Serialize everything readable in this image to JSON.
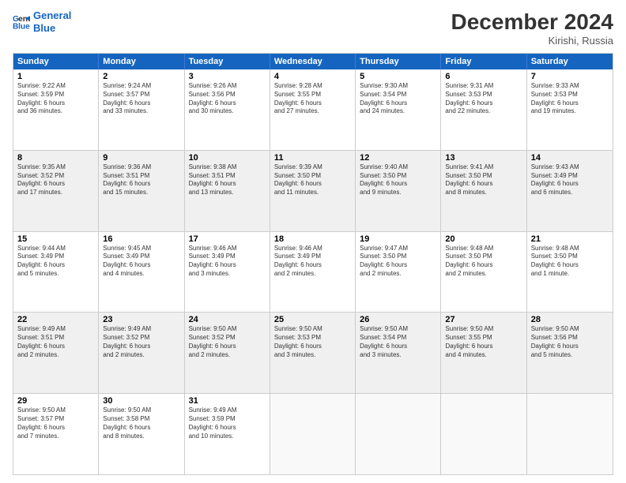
{
  "logo": {
    "line1": "General",
    "line2": "Blue"
  },
  "title": "December 2024",
  "subtitle": "Kirishi, Russia",
  "header_days": [
    "Sunday",
    "Monday",
    "Tuesday",
    "Wednesday",
    "Thursday",
    "Friday",
    "Saturday"
  ],
  "weeks": [
    [
      {
        "day": "1",
        "text": "Sunrise: 9:22 AM\nSunset: 3:59 PM\nDaylight: 6 hours\nand 36 minutes."
      },
      {
        "day": "2",
        "text": "Sunrise: 9:24 AM\nSunset: 3:57 PM\nDaylight: 6 hours\nand 33 minutes."
      },
      {
        "day": "3",
        "text": "Sunrise: 9:26 AM\nSunset: 3:56 PM\nDaylight: 6 hours\nand 30 minutes."
      },
      {
        "day": "4",
        "text": "Sunrise: 9:28 AM\nSunset: 3:55 PM\nDaylight: 6 hours\nand 27 minutes."
      },
      {
        "day": "5",
        "text": "Sunrise: 9:30 AM\nSunset: 3:54 PM\nDaylight: 6 hours\nand 24 minutes."
      },
      {
        "day": "6",
        "text": "Sunrise: 9:31 AM\nSunset: 3:53 PM\nDaylight: 6 hours\nand 22 minutes."
      },
      {
        "day": "7",
        "text": "Sunrise: 9:33 AM\nSunset: 3:53 PM\nDaylight: 6 hours\nand 19 minutes."
      }
    ],
    [
      {
        "day": "8",
        "text": "Sunrise: 9:35 AM\nSunset: 3:52 PM\nDaylight: 6 hours\nand 17 minutes."
      },
      {
        "day": "9",
        "text": "Sunrise: 9:36 AM\nSunset: 3:51 PM\nDaylight: 6 hours\nand 15 minutes."
      },
      {
        "day": "10",
        "text": "Sunrise: 9:38 AM\nSunset: 3:51 PM\nDaylight: 6 hours\nand 13 minutes."
      },
      {
        "day": "11",
        "text": "Sunrise: 9:39 AM\nSunset: 3:50 PM\nDaylight: 6 hours\nand 11 minutes."
      },
      {
        "day": "12",
        "text": "Sunrise: 9:40 AM\nSunset: 3:50 PM\nDaylight: 6 hours\nand 9 minutes."
      },
      {
        "day": "13",
        "text": "Sunrise: 9:41 AM\nSunset: 3:50 PM\nDaylight: 6 hours\nand 8 minutes."
      },
      {
        "day": "14",
        "text": "Sunrise: 9:43 AM\nSunset: 3:49 PM\nDaylight: 6 hours\nand 6 minutes."
      }
    ],
    [
      {
        "day": "15",
        "text": "Sunrise: 9:44 AM\nSunset: 3:49 PM\nDaylight: 6 hours\nand 5 minutes."
      },
      {
        "day": "16",
        "text": "Sunrise: 9:45 AM\nSunset: 3:49 PM\nDaylight: 6 hours\nand 4 minutes."
      },
      {
        "day": "17",
        "text": "Sunrise: 9:46 AM\nSunset: 3:49 PM\nDaylight: 6 hours\nand 3 minutes."
      },
      {
        "day": "18",
        "text": "Sunrise: 9:46 AM\nSunset: 3:49 PM\nDaylight: 6 hours\nand 2 minutes."
      },
      {
        "day": "19",
        "text": "Sunrise: 9:47 AM\nSunset: 3:50 PM\nDaylight: 6 hours\nand 2 minutes."
      },
      {
        "day": "20",
        "text": "Sunrise: 9:48 AM\nSunset: 3:50 PM\nDaylight: 6 hours\nand 2 minutes."
      },
      {
        "day": "21",
        "text": "Sunrise: 9:48 AM\nSunset: 3:50 PM\nDaylight: 6 hours\nand 1 minute."
      }
    ],
    [
      {
        "day": "22",
        "text": "Sunrise: 9:49 AM\nSunset: 3:51 PM\nDaylight: 6 hours\nand 2 minutes."
      },
      {
        "day": "23",
        "text": "Sunrise: 9:49 AM\nSunset: 3:52 PM\nDaylight: 6 hours\nand 2 minutes."
      },
      {
        "day": "24",
        "text": "Sunrise: 9:50 AM\nSunset: 3:52 PM\nDaylight: 6 hours\nand 2 minutes."
      },
      {
        "day": "25",
        "text": "Sunrise: 9:50 AM\nSunset: 3:53 PM\nDaylight: 6 hours\nand 3 minutes."
      },
      {
        "day": "26",
        "text": "Sunrise: 9:50 AM\nSunset: 3:54 PM\nDaylight: 6 hours\nand 3 minutes."
      },
      {
        "day": "27",
        "text": "Sunrise: 9:50 AM\nSunset: 3:55 PM\nDaylight: 6 hours\nand 4 minutes."
      },
      {
        "day": "28",
        "text": "Sunrise: 9:50 AM\nSunset: 3:56 PM\nDaylight: 6 hours\nand 5 minutes."
      }
    ],
    [
      {
        "day": "29",
        "text": "Sunrise: 9:50 AM\nSunset: 3:57 PM\nDaylight: 6 hours\nand 7 minutes."
      },
      {
        "day": "30",
        "text": "Sunrise: 9:50 AM\nSunset: 3:58 PM\nDaylight: 6 hours\nand 8 minutes."
      },
      {
        "day": "31",
        "text": "Sunrise: 9:49 AM\nSunset: 3:59 PM\nDaylight: 6 hours\nand 10 minutes."
      },
      {
        "day": "",
        "text": ""
      },
      {
        "day": "",
        "text": ""
      },
      {
        "day": "",
        "text": ""
      },
      {
        "day": "",
        "text": ""
      }
    ]
  ]
}
